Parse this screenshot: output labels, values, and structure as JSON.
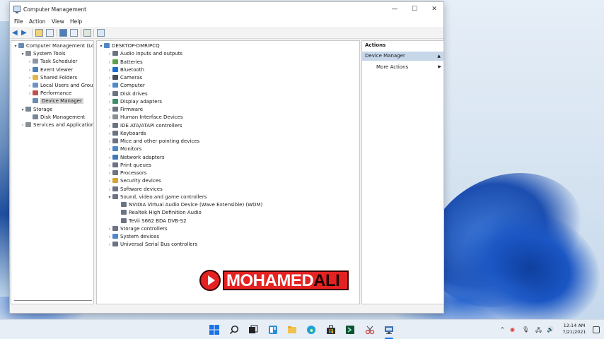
{
  "window": {
    "title": "Computer Management",
    "controls": {
      "minimize": "—",
      "maximize": "☐",
      "close": "✕"
    }
  },
  "menu": [
    "File",
    "Action",
    "View",
    "Help"
  ],
  "left_tree": {
    "root": "Computer Management (Local",
    "items": [
      {
        "label": "System Tools",
        "level": 1,
        "expander": "▾",
        "icon_color": "#8a8f96"
      },
      {
        "label": "Task Scheduler",
        "level": 2,
        "expander": "›",
        "icon_color": "#8b96a3"
      },
      {
        "label": "Event Viewer",
        "level": 2,
        "expander": "›",
        "icon_color": "#4f7fb8"
      },
      {
        "label": "Shared Folders",
        "level": 2,
        "expander": "›",
        "icon_color": "#e2b74a"
      },
      {
        "label": "Local Users and Groups",
        "level": 2,
        "expander": "›",
        "icon_color": "#6c93c4"
      },
      {
        "label": "Performance",
        "level": 2,
        "expander": "›",
        "icon_color": "#c0504d"
      },
      {
        "label": "Device Manager",
        "level": 2,
        "expander": "",
        "icon_color": "#6a8bb3",
        "selected": true
      },
      {
        "label": "Storage",
        "level": 1,
        "expander": "▾",
        "icon_color": "#7a8795"
      },
      {
        "label": "Disk Management",
        "level": 2,
        "expander": "",
        "icon_color": "#7a8795"
      },
      {
        "label": "Services and Applications",
        "level": 1,
        "expander": "›",
        "icon_color": "#8a8f96"
      }
    ]
  },
  "device_tree": {
    "root": "DESKTOP-DMRIPCQ",
    "items": [
      {
        "label": "Audio inputs and outputs",
        "level": 1,
        "expander": "›",
        "icon_color": "#6b7480"
      },
      {
        "label": "Batteries",
        "level": 1,
        "expander": "›",
        "icon_color": "#5fa24b"
      },
      {
        "label": "Bluetooth",
        "level": 1,
        "expander": "›",
        "icon_color": "#1f6fd1"
      },
      {
        "label": "Cameras",
        "level": 1,
        "expander": "›",
        "icon_color": "#4a4f57"
      },
      {
        "label": "Computer",
        "level": 1,
        "expander": "›",
        "icon_color": "#4f88c6"
      },
      {
        "label": "Disk drives",
        "level": 1,
        "expander": "›",
        "icon_color": "#6b7480"
      },
      {
        "label": "Display adapters",
        "level": 1,
        "expander": "›",
        "icon_color": "#3f8d6b"
      },
      {
        "label": "Firmware",
        "level": 1,
        "expander": "›",
        "icon_color": "#6b7480"
      },
      {
        "label": "Human Interface Devices",
        "level": 1,
        "expander": "›",
        "icon_color": "#8a8f96"
      },
      {
        "label": "IDE ATA/ATAPI controllers",
        "level": 1,
        "expander": "›",
        "icon_color": "#6b7480"
      },
      {
        "label": "Keyboards",
        "level": 1,
        "expander": "›",
        "icon_color": "#6b7480"
      },
      {
        "label": "Mice and other pointing devices",
        "level": 1,
        "expander": "›",
        "icon_color": "#6b7480"
      },
      {
        "label": "Monitors",
        "level": 1,
        "expander": "›",
        "icon_color": "#4f88c6"
      },
      {
        "label": "Network adapters",
        "level": 1,
        "expander": "›",
        "icon_color": "#3f78b8"
      },
      {
        "label": "Print queues",
        "level": 1,
        "expander": "›",
        "icon_color": "#6b7480"
      },
      {
        "label": "Processors",
        "level": 1,
        "expander": "›",
        "icon_color": "#6b7480"
      },
      {
        "label": "Security devices",
        "level": 1,
        "expander": "›",
        "icon_color": "#d8a431"
      },
      {
        "label": "Software devices",
        "level": 1,
        "expander": "›",
        "icon_color": "#6b7480"
      },
      {
        "label": "Sound, video and game controllers",
        "level": 1,
        "expander": "▾",
        "icon_color": "#6b7480"
      },
      {
        "label": "NVIDIA Virtual Audio Device (Wave Extensible) (WDM)",
        "level": 2,
        "expander": "",
        "icon_color": "#6b7480"
      },
      {
        "label": "Realtek High Definition Audio",
        "level": 2,
        "expander": "",
        "icon_color": "#6b7480"
      },
      {
        "label": "TeVii S662 BDA DVB-S2",
        "level": 2,
        "expander": "",
        "icon_color": "#6b7480"
      },
      {
        "label": "Storage controllers",
        "level": 1,
        "expander": "›",
        "icon_color": "#6b7480"
      },
      {
        "label": "System devices",
        "level": 1,
        "expander": "›",
        "icon_color": "#4f88c6"
      },
      {
        "label": "Universal Serial Bus controllers",
        "level": 1,
        "expander": "›",
        "icon_color": "#6b7480"
      }
    ]
  },
  "actions": {
    "header": "Actions",
    "section": "Device Manager",
    "section_caret": "▲",
    "more": "More Actions",
    "more_caret": "▶"
  },
  "watermark": {
    "part1": "MOHAMED",
    "part2": "ALI"
  },
  "taskbar": {
    "time": "12:14 AM",
    "date": "7/21/2021",
    "tray": [
      "^",
      "◉",
      "🎙",
      "🖧",
      "🔊"
    ]
  }
}
